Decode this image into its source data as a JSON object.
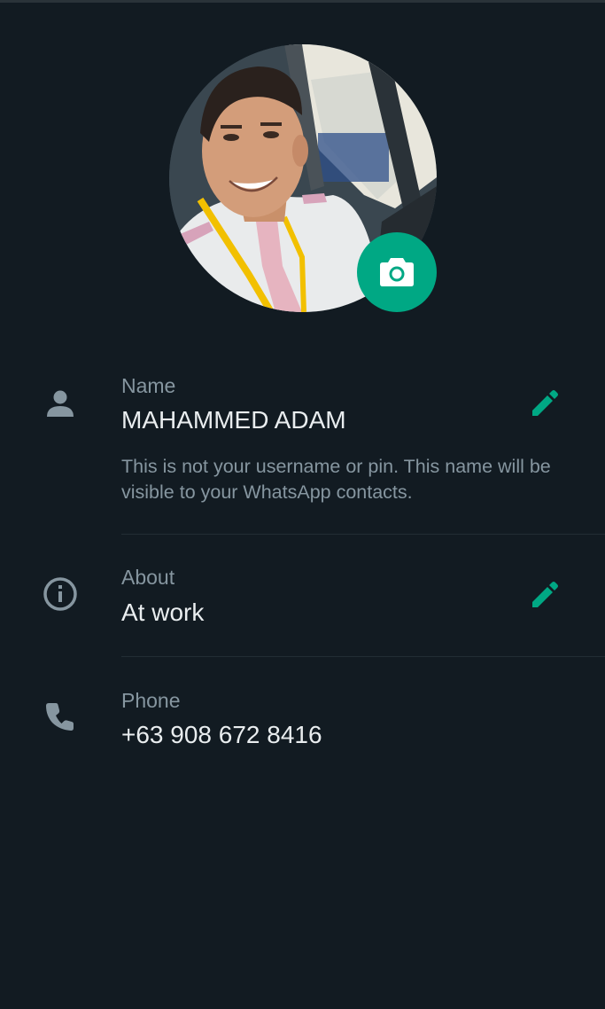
{
  "profile": {
    "photo_alt": "profile-photo",
    "camera_icon": "camera-icon"
  },
  "name_section": {
    "icon": "person-icon",
    "label": "Name",
    "value": "MAHAMMED ADAM",
    "hint": "This is not your username or pin. This name will be visible to your WhatsApp contacts.",
    "edit_icon": "pencil-icon"
  },
  "about_section": {
    "icon": "info-icon",
    "label": "About",
    "value": "At work",
    "edit_icon": "pencil-icon"
  },
  "phone_section": {
    "icon": "phone-icon",
    "label": "Phone",
    "value": "+63 908 672 8416"
  },
  "colors": {
    "background": "#121b22",
    "accent": "#00a884",
    "text_primary": "#e9edef",
    "text_secondary": "#8696a0",
    "divider": "#222d34"
  }
}
